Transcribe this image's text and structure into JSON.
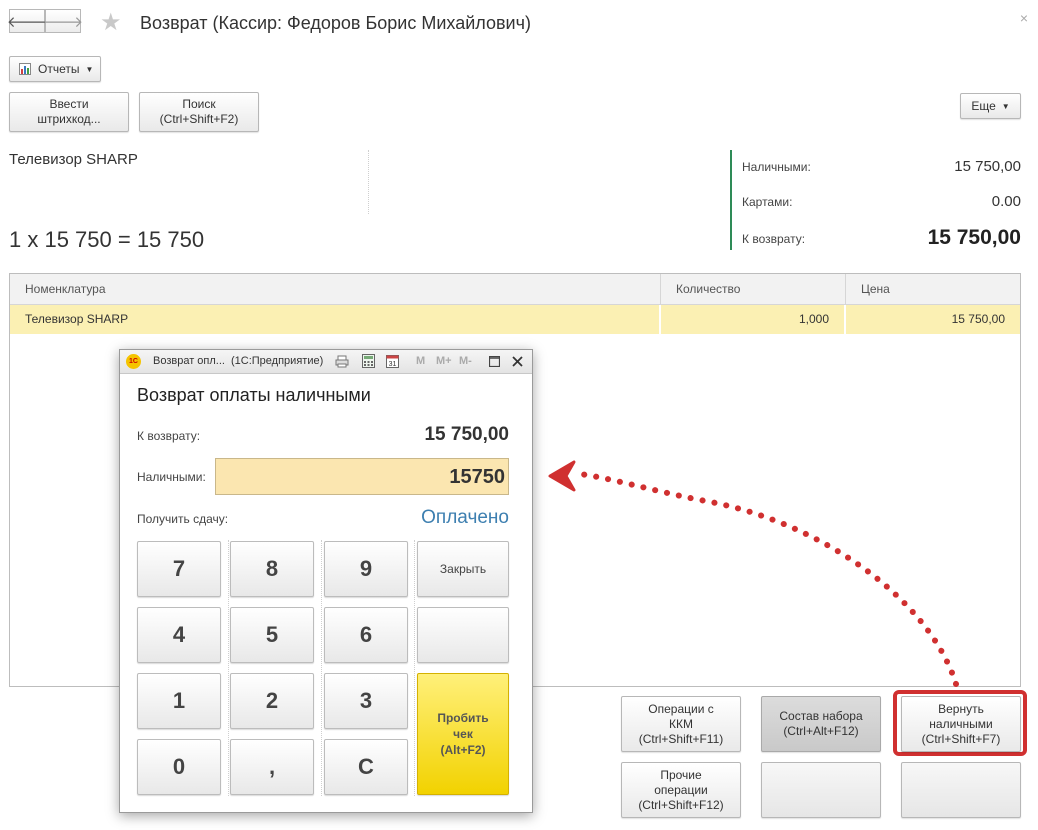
{
  "window": {
    "title": "Возврат (Кассир: Федоров Борис Михайлович)",
    "close_glyph": "×",
    "back_glyph": "🡐",
    "forward_glyph": "🡒",
    "star_glyph": "★"
  },
  "toolbar": {
    "reports_label": "Отчеты",
    "barcode_label_1": "Ввести",
    "barcode_label_2": "штрихкод...",
    "search_label_1": "Поиск",
    "search_label_2": "(Ctrl+Shift+F2)",
    "more_label": "Еще"
  },
  "item_info": {
    "product_name": "Телевизор SHARP",
    "calc_line": "1 х 15 750 = 15 750"
  },
  "summary": {
    "cash_label": "Наличными:",
    "cash_value": "15 750,00",
    "cards_label": "Картами:",
    "cards_value": "0.00",
    "refund_label": "К возврату:",
    "refund_value": "15 750,00",
    "accent_color": "#2e8b57"
  },
  "table": {
    "columns": [
      "Номенклатура",
      "Количество",
      "Цена"
    ],
    "rows": [
      {
        "name": "Телевизор SHARP",
        "qty": "1,000",
        "price": "15 750,00"
      }
    ]
  },
  "bottom_buttons": {
    "kkm_1": "Операции с",
    "kkm_2": "ККМ",
    "kkm_3": "(Ctrl+Shift+F11)",
    "bundle_1": "Состав набора",
    "bundle_2": "(Ctrl+Alt+F12)",
    "return_cash_1": "Вернуть",
    "return_cash_2": "наличными",
    "return_cash_3": "(Ctrl+Shift+F7)",
    "other_1": "Прочие",
    "other_2": "операции",
    "other_3": "(Ctrl+Shift+F12)"
  },
  "dialog": {
    "window_title": "Возврат опл...",
    "app_name": "(1С:Предприятие)",
    "logo_text": "1С",
    "m_label": "M",
    "mplus_label": "M+",
    "mminus_label": "M-",
    "heading": "Возврат оплаты наличными",
    "refund_label": "К возврату:",
    "refund_value": "15 750,00",
    "cash_label": "Наличными:",
    "cash_input_value": "15750",
    "change_label": "Получить сдачу:",
    "status_text": "Оплачено",
    "keys": [
      "7",
      "8",
      "9",
      "4",
      "5",
      "6",
      "1",
      "2",
      "3",
      "0",
      ",",
      "C"
    ],
    "close_key": "Закрыть",
    "pay_key_1": "Пробить",
    "pay_key_2": "чек",
    "pay_key_3": "(Alt+F2)",
    "highlight_color": "#fbe6b0",
    "status_color": "#3d7fb0"
  },
  "annotation": {
    "arrow_color": "#d03030"
  }
}
